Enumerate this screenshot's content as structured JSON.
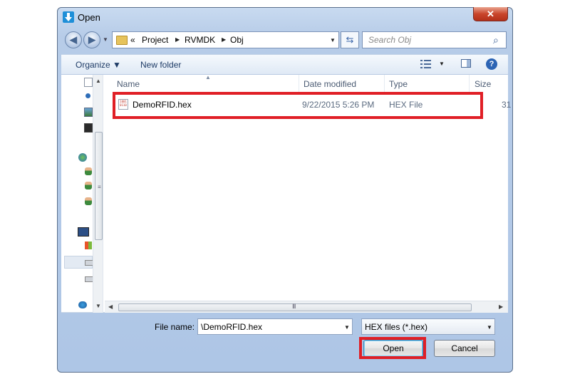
{
  "window": {
    "title": "Open",
    "close_label": "✕"
  },
  "nav": {
    "back_label": "◀",
    "forward_label": "▶"
  },
  "address": {
    "overflow": "«",
    "breadcrumbs": [
      "Project",
      "RVMDK",
      "Obj"
    ],
    "separator": "▶"
  },
  "search": {
    "placeholder": "Search Obj"
  },
  "toolbar": {
    "organize_label": "Organize ▼",
    "new_folder_label": "New folder",
    "help_label": "?"
  },
  "columns": {
    "name": "Name",
    "date_modified": "Date modified",
    "type": "Type",
    "size": "Size"
  },
  "files": [
    {
      "name": "DemoRFID.hex",
      "date_modified": "9/22/2015 5:26 PM",
      "type": "HEX File",
      "size": "31",
      "icon": "hex-file-icon",
      "icon_text": "1001 0110"
    }
  ],
  "scroll": {
    "grip": "III"
  },
  "footer": {
    "file_name_label": "File name:",
    "file_name_value": "\\DemoRFID.hex",
    "filter_value": "HEX files (*.hex)",
    "open_label": "Open",
    "cancel_label": "Cancel"
  },
  "colors": {
    "highlight": "#e01f26",
    "window_frame": "#aec6e6",
    "link_text": "#1e3b66"
  }
}
